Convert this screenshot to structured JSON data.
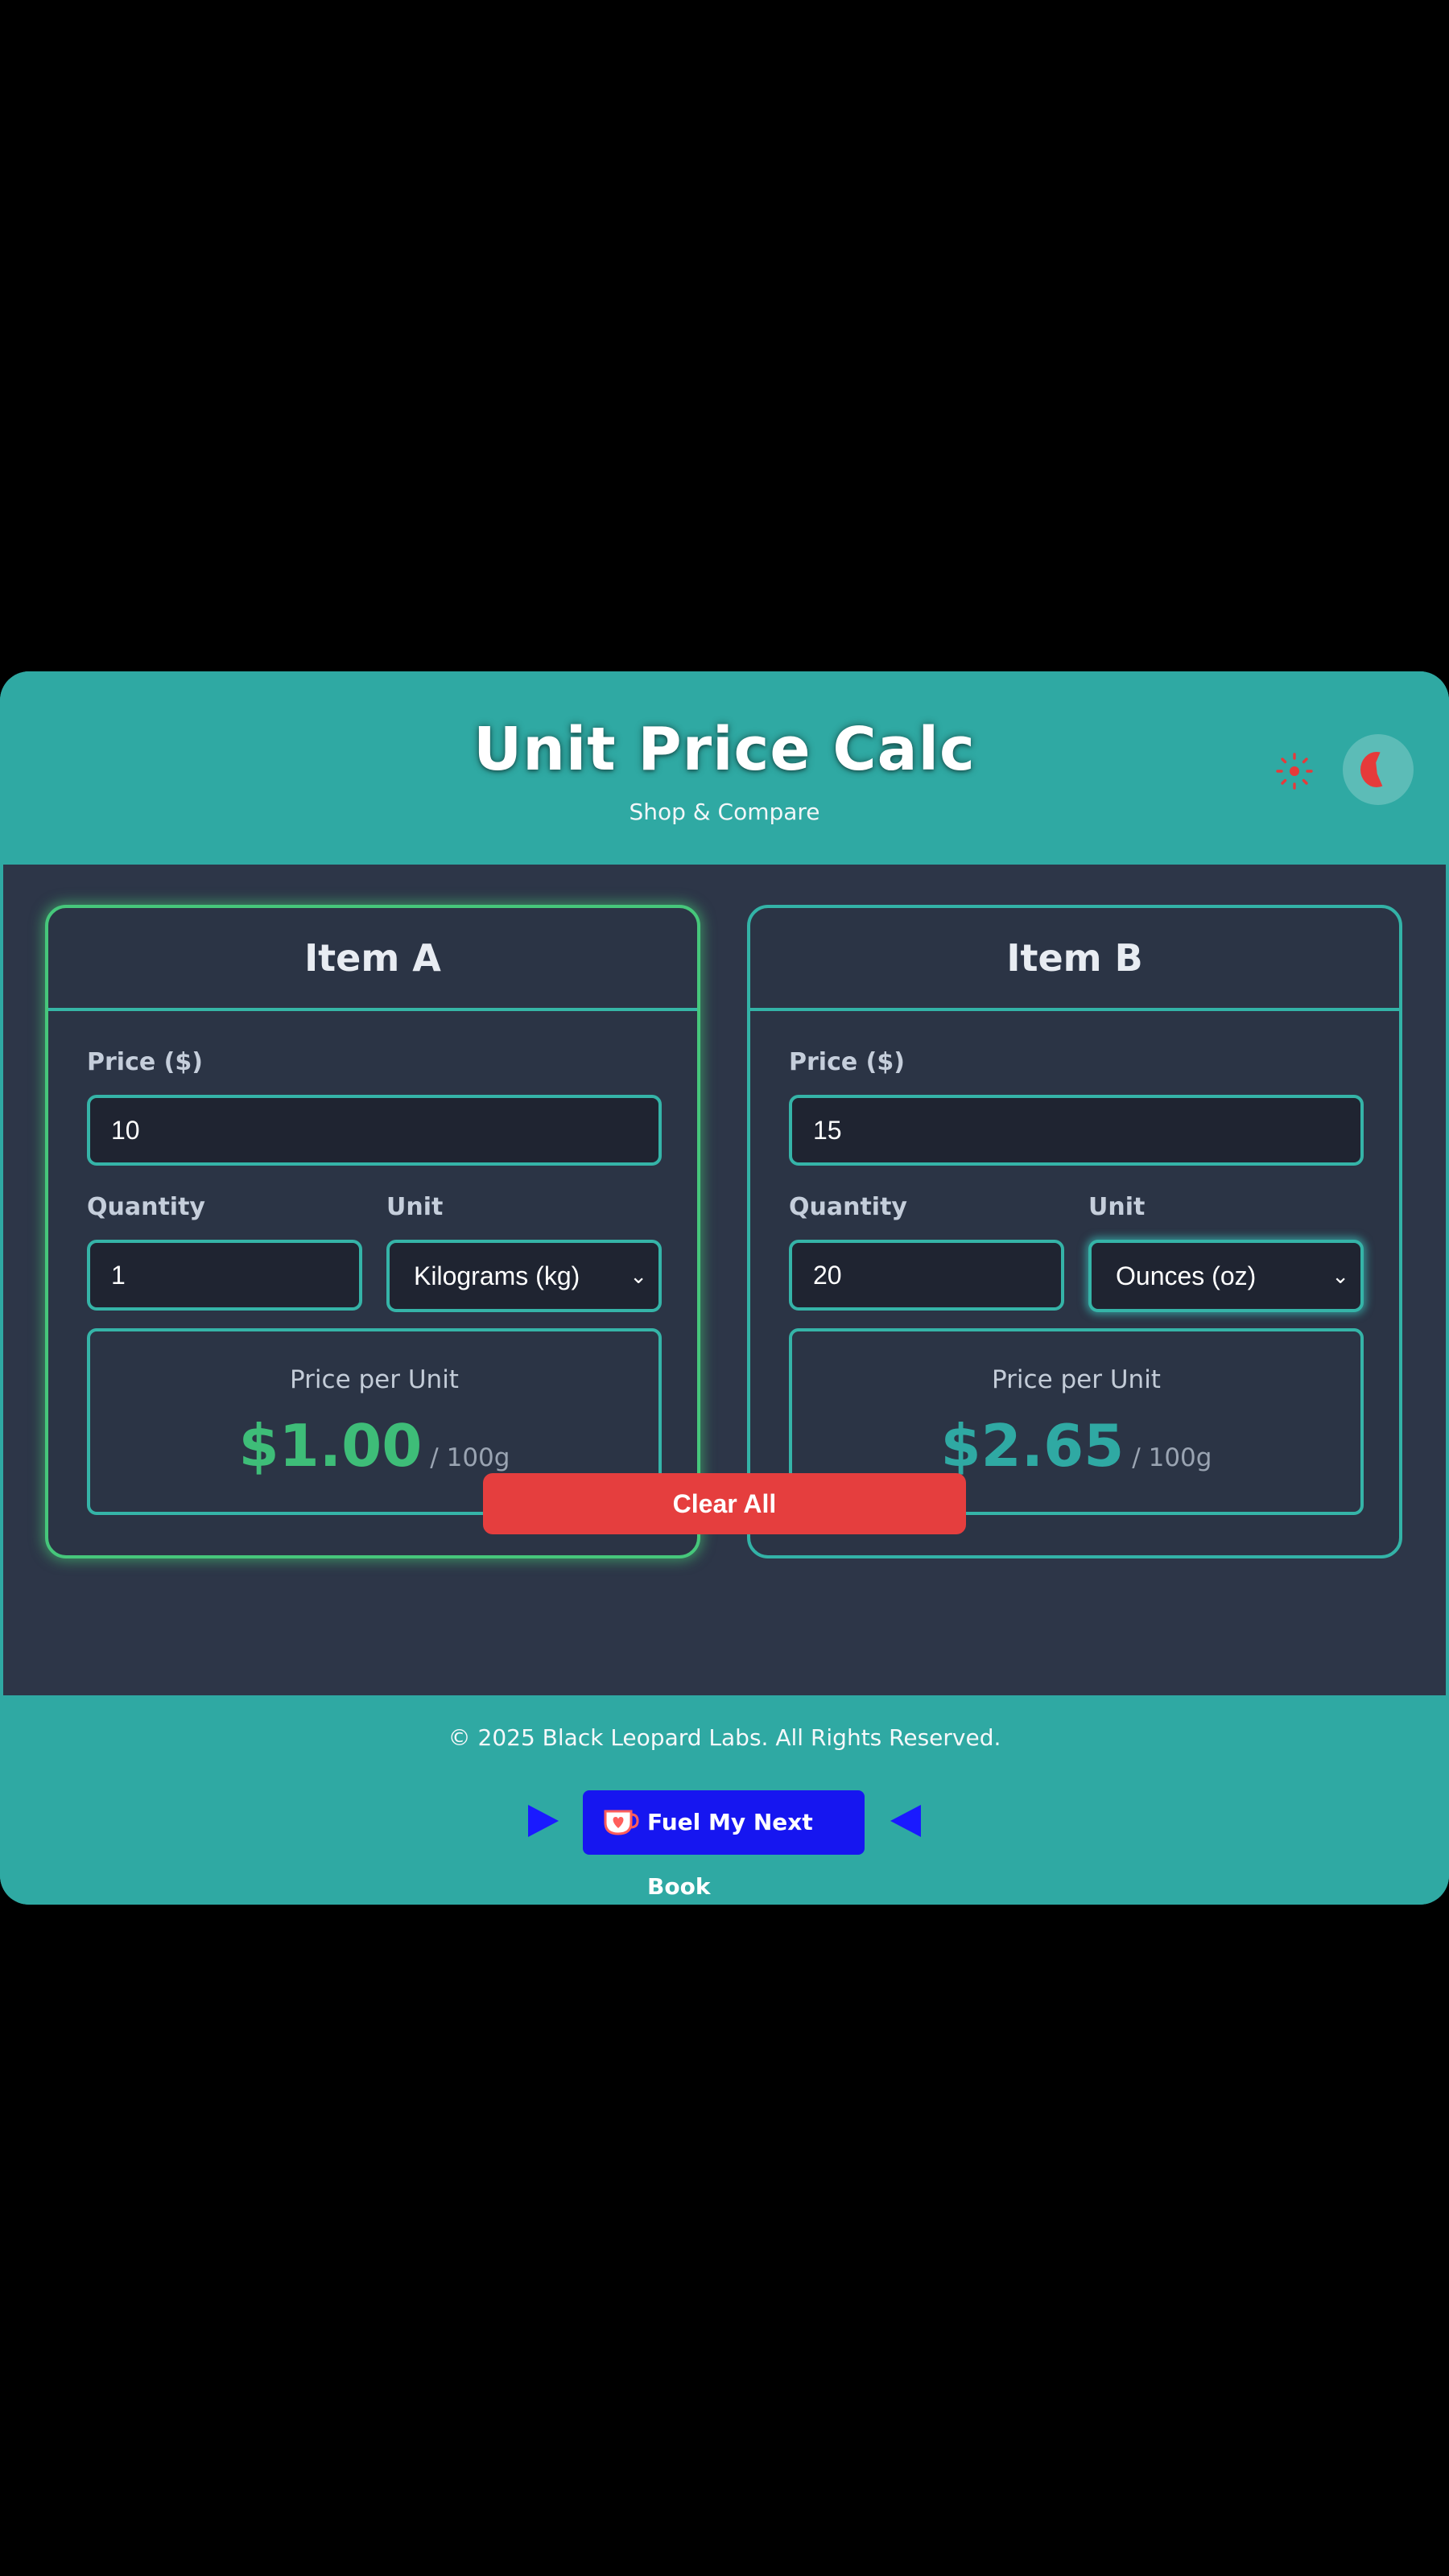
{
  "header": {
    "title": "Unit Price Calc",
    "subtitle": "Shop & Compare",
    "brightness_icon": "sun-icon",
    "theme_icon": "moon-icon"
  },
  "items": [
    {
      "title": "Item A",
      "price_label": "Price ($)",
      "price_value": "10",
      "quantity_label": "Quantity",
      "quantity_value": "1",
      "unit_label": "Unit",
      "unit_selected": "Kilograms (kg)",
      "result_label": "Price per Unit",
      "result_value": "$1.00",
      "result_unit": "/ 100g",
      "result_color": "#3ebd78"
    },
    {
      "title": "Item B",
      "price_label": "Price ($)",
      "price_value": "15",
      "quantity_label": "Quantity",
      "quantity_value": "20",
      "unit_label": "Unit",
      "unit_selected": "Ounces (oz)",
      "result_label": "Price per Unit",
      "result_value": "$2.65",
      "result_unit": "/ 100g",
      "result_color": "#2fa9a3"
    }
  ],
  "actions": {
    "clear_label": "Clear All",
    "clear_color": "#e53e3e"
  },
  "footer": {
    "copyright": "© 2025 Black Leopard Labs. All Rights Reserved.",
    "support_label": "Fuel My Next Book",
    "support_icon": "coffee-cup-icon",
    "support_color": "#1616f0"
  },
  "colors": {
    "brand": "#2fa9a3",
    "panel": "#2d3648",
    "accent_border": "#35b4a8",
    "best_deal_glow": "#46c77b"
  }
}
